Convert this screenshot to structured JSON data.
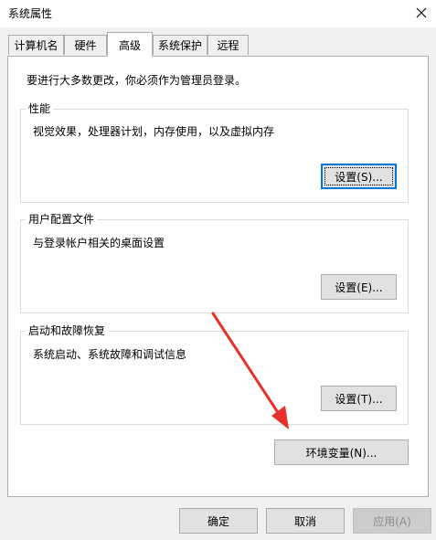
{
  "window": {
    "title": "系统属性",
    "close_glyph": "✕"
  },
  "tabs": [
    {
      "label": "计算机名"
    },
    {
      "label": "硬件"
    },
    {
      "label": "高级"
    },
    {
      "label": "系统保护"
    },
    {
      "label": "远程"
    }
  ],
  "active_tab": "高级",
  "notice": "要进行大多数更改，你必须作为管理员登录。",
  "performance": {
    "title": "性能",
    "description": "视觉效果，处理器计划，内存使用，以及虚拟内存",
    "button": "设置(S)..."
  },
  "user_profiles": {
    "title": "用户配置文件",
    "description": "与登录帐户相关的桌面设置",
    "button": "设置(E)..."
  },
  "startup_recovery": {
    "title": "启动和故障恢复",
    "description": "系统启动、系统故障和调试信息",
    "button": "设置(T)..."
  },
  "env_button": "环境变量(N)...",
  "footer": {
    "ok": "确定",
    "cancel": "取消",
    "apply": "应用(A)"
  },
  "colors": {
    "accent": "#0078d7",
    "arrow": "#e8302c"
  }
}
